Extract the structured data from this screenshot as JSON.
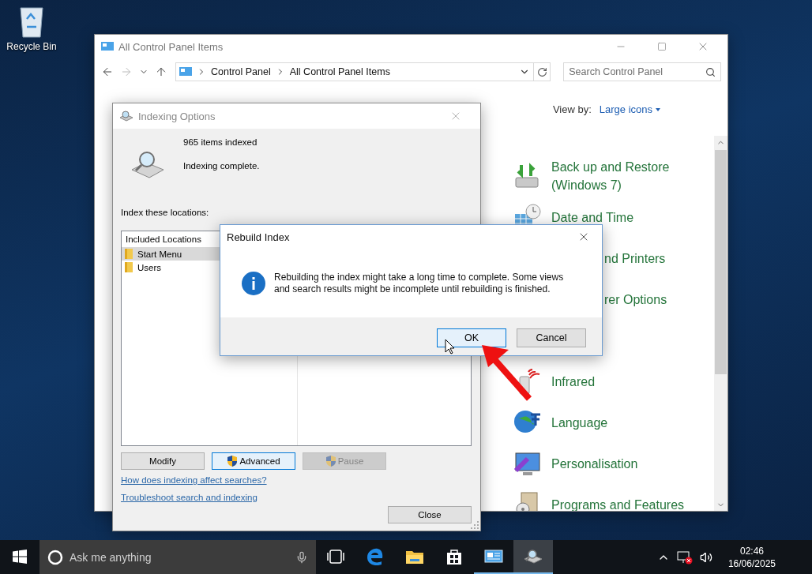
{
  "desktop": {
    "icons": [
      {
        "label": "Recycle Bin"
      }
    ]
  },
  "control_panel": {
    "title": "All Control Panel Items",
    "address": {
      "crumbs": [
        "Control Panel",
        "All Control Panel Items"
      ]
    },
    "search": {
      "placeholder": "Search Control Panel"
    },
    "view_by": {
      "label": "View by:",
      "value": "Large icons"
    },
    "items": [
      {
        "kind": "backup",
        "label": "Back up and Restore (Windows 7)"
      },
      {
        "kind": "datetime",
        "label": "Date and Time"
      },
      {
        "kind": "covered",
        "label": "nd Printers"
      },
      {
        "kind": "covered",
        "label": "rer Options"
      },
      {
        "kind": "hidden"
      },
      {
        "kind": "infrared",
        "label": "Infrared"
      },
      {
        "kind": "language",
        "label": "Language"
      },
      {
        "kind": "personalisation",
        "label": "Personalisation"
      },
      {
        "kind": "programs",
        "label": "Programs and Features"
      }
    ]
  },
  "indexing_options": {
    "title": "Indexing Options",
    "count": "965 items indexed",
    "status": "Indexing complete.",
    "locations_label": "Index these locations:",
    "table": {
      "columns": [
        "Included Locations"
      ],
      "rows": [
        {
          "name": "Start Menu",
          "selected": true
        },
        {
          "name": "Users",
          "selected": false
        }
      ]
    },
    "buttons": [
      {
        "kind": "plain",
        "label": "Modify",
        "focused": false,
        "disabled": false
      },
      {
        "kind": "shield",
        "label": "Advanced",
        "focused": true,
        "disabled": false
      },
      {
        "kind": "shield",
        "label": "Pause",
        "focused": false,
        "disabled": true
      }
    ],
    "links": [
      "How does indexing affect searches?",
      "Troubleshoot search and indexing"
    ],
    "close_button": "Close"
  },
  "rebuild_dialog": {
    "title": "Rebuild Index",
    "message": "Rebuilding the index might take a long time to complete. Some views and search results might be incomplete until rebuilding is finished.",
    "buttons": [
      {
        "label": "OK",
        "focused": true
      },
      {
        "label": "Cancel",
        "focused": false
      }
    ]
  },
  "taskbar": {
    "search": {
      "placeholder": "Ask me anything"
    },
    "apps": [
      {
        "kind": "task-view",
        "open": false,
        "active": false
      },
      {
        "kind": "edge",
        "open": false,
        "active": false
      },
      {
        "kind": "explorer",
        "open": false,
        "active": false
      },
      {
        "kind": "store",
        "open": false,
        "active": false
      },
      {
        "kind": "control-panel",
        "open": true,
        "active": false
      },
      {
        "kind": "indexing",
        "open": true,
        "active": true
      }
    ],
    "clock": {
      "time": "02:46",
      "date": "16/06/2025"
    }
  }
}
